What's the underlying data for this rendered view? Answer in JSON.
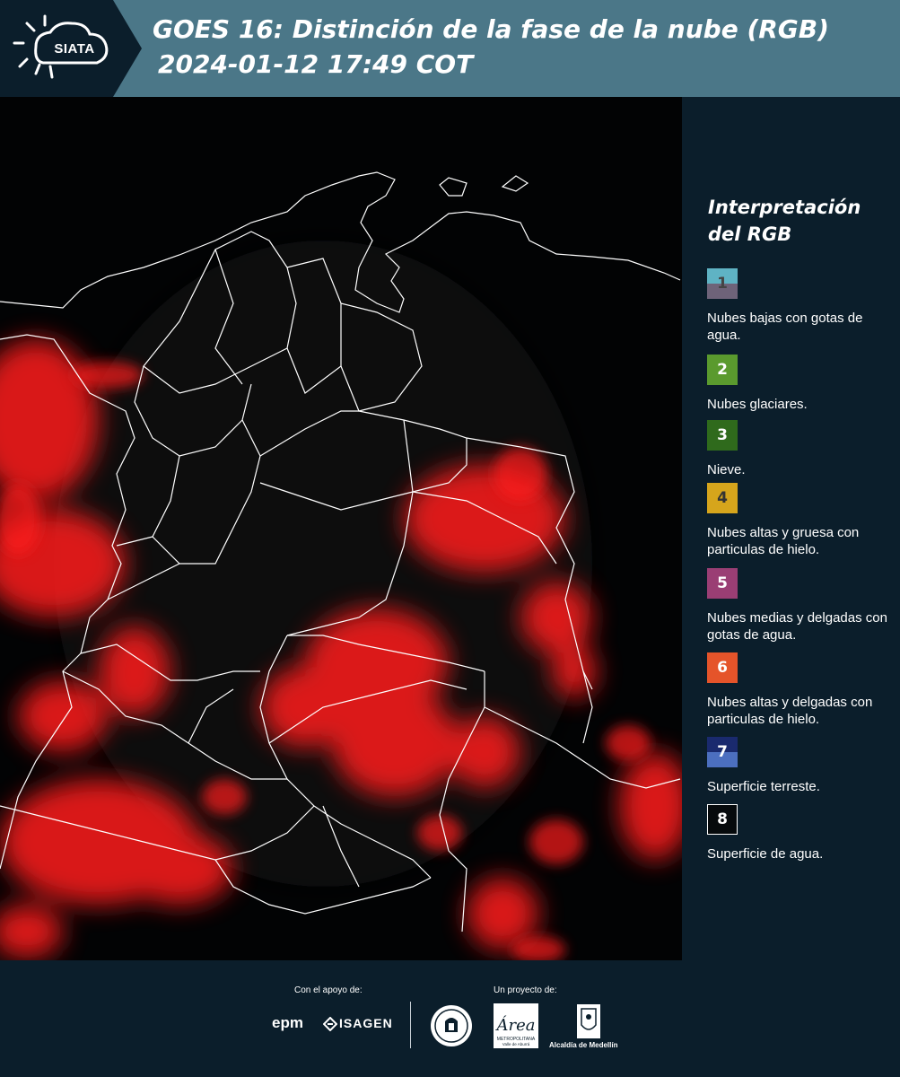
{
  "header": {
    "logo": "SIATA",
    "title": "GOES 16: Distinción de la fase de la nube (RGB)",
    "datetime": "2024-01-12 17:49 COT"
  },
  "legend": {
    "title_line1": "Interpretación",
    "title_line2": "del RGB",
    "items": [
      {
        "number": "1",
        "label": "Nubes bajas con gotas de agua.",
        "color_top": "#5fb3c4",
        "color_bottom": "#6e6379",
        "text_color": "#444444"
      },
      {
        "number": "2",
        "label": "Nubes glaciares.",
        "color": "#5a9a2e"
      },
      {
        "number": "3",
        "label": "Nieve.",
        "color": "#2f6a1c"
      },
      {
        "number": "4",
        "label": "Nubes altas y gruesa con particulas de hielo.",
        "color": "#d6a51c",
        "text_color": "#333333"
      },
      {
        "number": "5",
        "label": "Nubes medias y delgadas con gotas de agua.",
        "color": "#9a3e74"
      },
      {
        "number": "6",
        "label": "Nubes altas y delgadas con particulas de hielo.",
        "color": "#e5542a"
      },
      {
        "number": "7",
        "label": "Superficie terreste.",
        "color_top": "#1a2a6e",
        "color_bottom": "#4c6fbf"
      },
      {
        "number": "8",
        "label": "Superficie de agua.",
        "color": "#060a0c",
        "border": "#ffffff"
      }
    ]
  },
  "footer": {
    "support_caption": "Con el apoyo de:",
    "project_caption": "Un proyecto de:",
    "sponsors": [
      "epm",
      "ISAGEN"
    ],
    "area_logo": "Área",
    "area_subtitle": "METROPOLITANA",
    "area_subtitle2": "Valle de Aburrá",
    "alcaldia": "Alcaldía de Medellín"
  },
  "map": {
    "cloud_color": "#ff1a1a",
    "border_color": "#ffffff",
    "background": "#020304"
  }
}
